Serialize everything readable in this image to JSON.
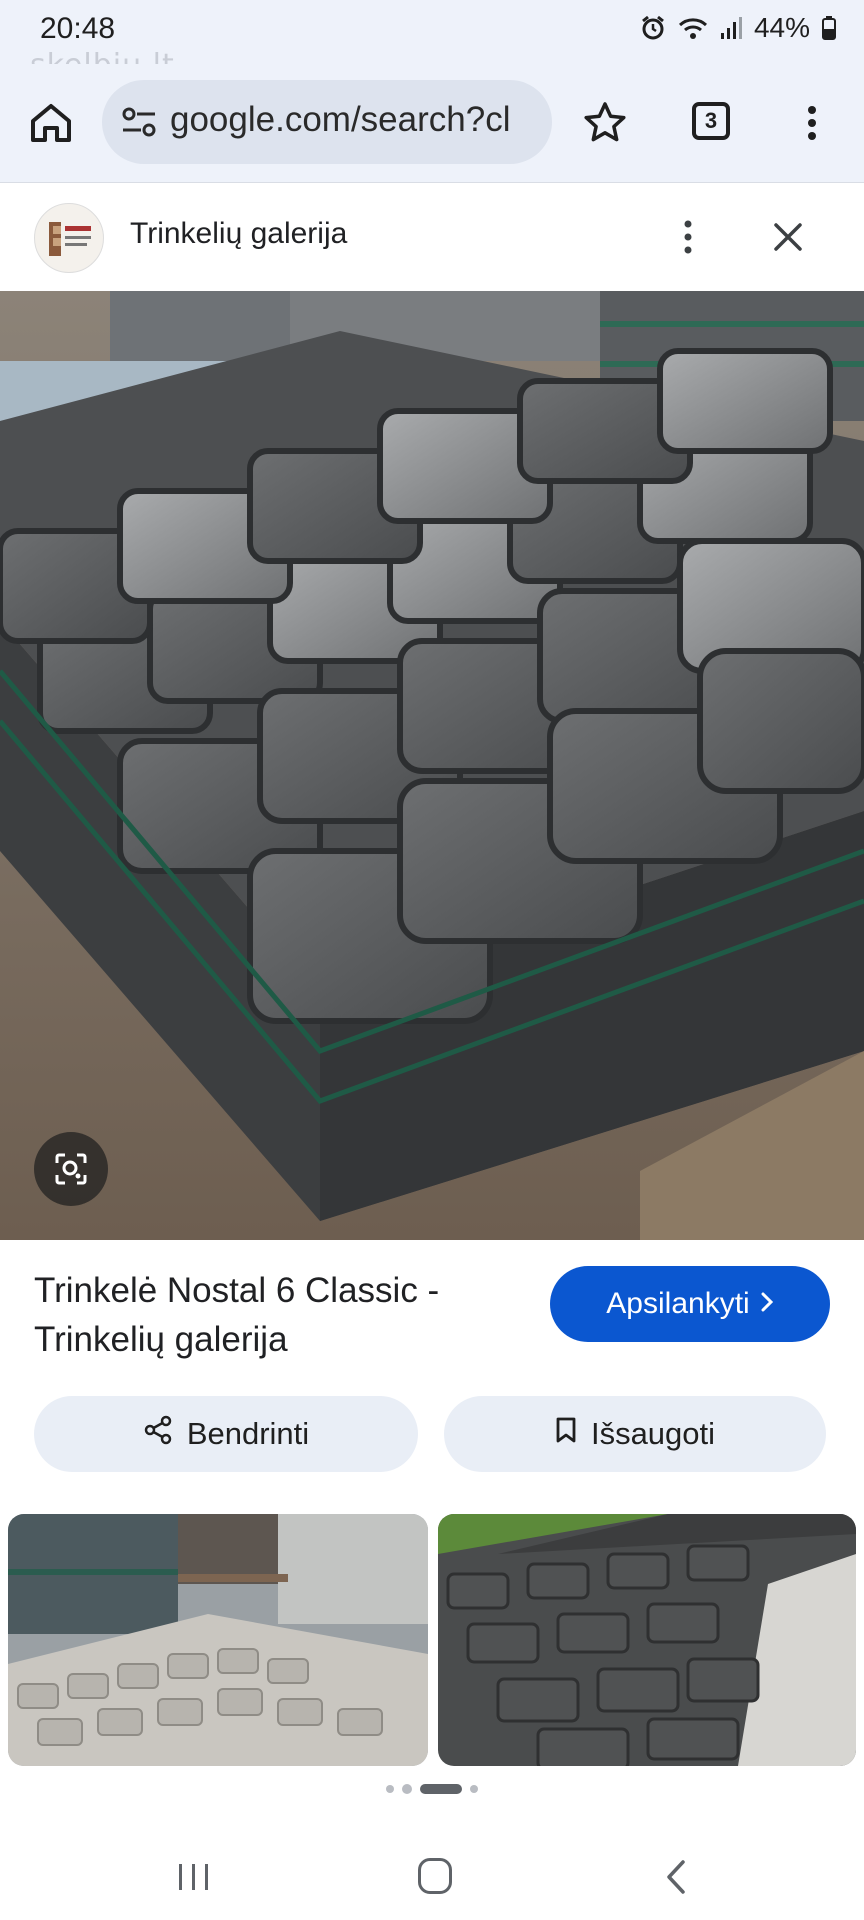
{
  "status_bar": {
    "time": "20:48",
    "battery": "44%",
    "icons": [
      "alarm-icon",
      "wifi-icon",
      "signal-icon",
      "battery-icon"
    ],
    "watermark": "skelbiu.lt"
  },
  "browser": {
    "url": "google.com/search?cl",
    "tab_count": "3",
    "icons": [
      "home-icon",
      "tune-icon",
      "star-icon",
      "tabs-icon",
      "more-vert-icon"
    ]
  },
  "panel": {
    "site_name": "Trinkelių galerija",
    "logo_text": "TRINKELIŲ GALERIJA",
    "title": "Trinkelė Nostal 6 Classic - Trinkelių galerija",
    "visit_label": "Apsilankyti",
    "share_label": "Bendrinti",
    "save_label": "Išsaugoti"
  },
  "pagination": {
    "count": 4,
    "active": 2
  },
  "colors": {
    "accent": "#0b57d0",
    "chip_bg": "#e9eef6",
    "toolbar_bg": "#eef2fa"
  }
}
